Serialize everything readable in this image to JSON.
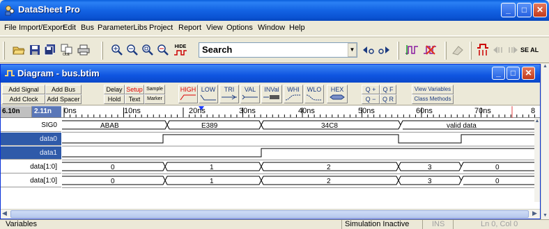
{
  "app": {
    "title": "DataSheet Pro"
  },
  "menu": [
    "File",
    "Import/Export",
    "Edit",
    "Bus",
    "ParameterLibs",
    "Project",
    "Report",
    "View",
    "Options",
    "Window",
    "Help"
  ],
  "toolbar": {
    "search_value": "Search",
    "hide_label": "HIDE",
    "right_label": "SE AL"
  },
  "diagram_window": {
    "title": "Diagram - bus.btim",
    "buttons": {
      "add_signal": "Add Signal",
      "add_bus": "Add Bus",
      "add_clock": "Add Clock",
      "add_spacer": "Add Spacer",
      "delay": "Delay",
      "setup": "Setup",
      "sample": "Sample",
      "hold": "Hold",
      "text": "Text",
      "marker": "Marker",
      "high": "HIGH",
      "low": "LOW",
      "tri": "TRI",
      "val": "VAL",
      "inval": "INVal",
      "whi": "WHI",
      "wlo": "WLO",
      "hex": "HEX",
      "zoom_in": "Q +",
      "zoom_full": "Q F",
      "zoom_out": "Q −",
      "zoom_range": "Q R",
      "view_variables": "View Variables",
      "class_methods": "Class Methods"
    },
    "cursor_a": "6.10n",
    "cursor_b": "2.11n",
    "ruler_labels": [
      "0ns",
      "10ns",
      "20ns",
      "30ns",
      "40ns",
      "50ns",
      "60ns",
      "70ns",
      "8"
    ],
    "signals": [
      {
        "name": "SIG0",
        "type": "bus",
        "selected": false,
        "segments": [
          "ABAB",
          "E389",
          "34C8",
          "valid data"
        ]
      },
      {
        "name": "data0",
        "type": "bit",
        "selected": true
      },
      {
        "name": "data1",
        "type": "bit",
        "selected": true
      },
      {
        "name": "data[1:0]",
        "type": "bus",
        "selected": false,
        "segments": [
          "0",
          "1",
          "2",
          "3",
          "0"
        ]
      },
      {
        "name": "data[1:0]",
        "type": "bus",
        "selected": false,
        "segments": [
          "0",
          "1",
          "2",
          "3",
          "0"
        ]
      }
    ]
  },
  "status": {
    "left": "Variables",
    "sim": "Simulation Inactive",
    "mode": "INS",
    "position": "Ln 0, Col 0"
  },
  "colors": {
    "title_blue": "#0A52D3",
    "selected_row": "#2F5AA9",
    "close_red": "#C1391B"
  }
}
